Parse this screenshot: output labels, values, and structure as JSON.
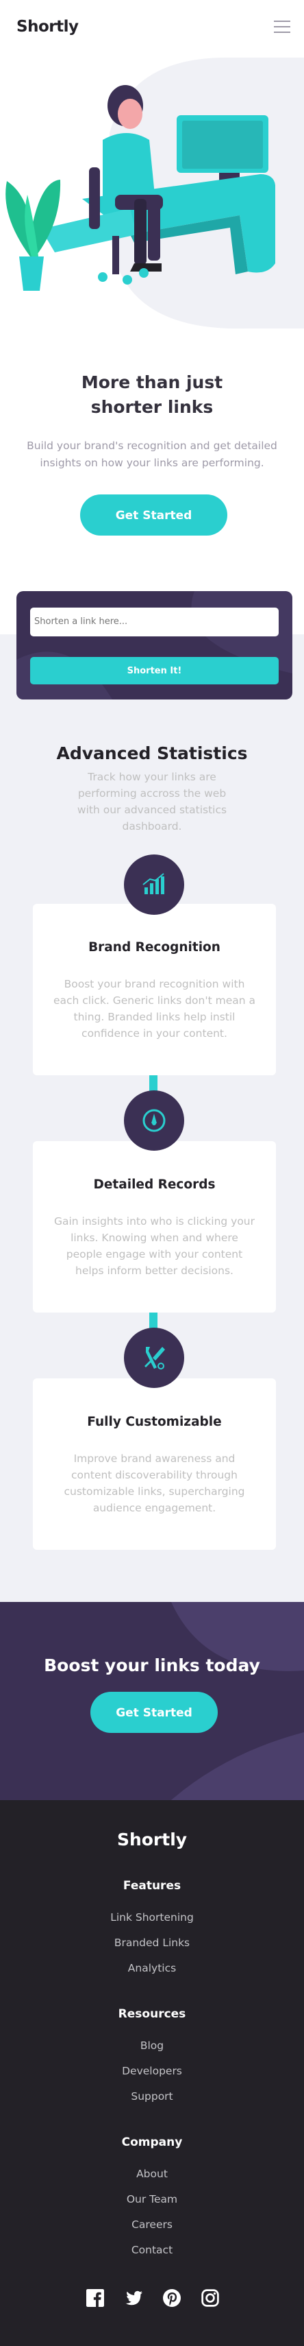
{
  "header": {
    "logo": "Shortly",
    "menu_icon": "hamburger-menu-icon"
  },
  "hero": {
    "title_line1": "More than just",
    "title_line2": "shorter links",
    "subtitle_line1": "Build your brand's recognition and get detailed",
    "subtitle_line2": "insights on how your links are performing.",
    "cta_label": "Get Started",
    "illustration": "person-working-at-desk-illustration"
  },
  "shorten": {
    "placeholder": "Shorten a link here...",
    "button_label": "Shorten It!"
  },
  "stats": {
    "title": "Advanced Statistics",
    "subtitle_lines": [
      "Track how your links are",
      "performing accross the web",
      "with our advanced statistics",
      "dashboard."
    ],
    "cards": [
      {
        "icon": "brand-recognition-chart-icon",
        "title": "Brand Recognition",
        "text_lines": [
          "Boost your brand recognition with",
          "each click. Generic links don't mean a",
          "thing. Branded links help instil",
          "confidence in your content."
        ]
      },
      {
        "icon": "detailed-records-gauge-icon",
        "title": "Detailed Records",
        "text_lines": [
          "Gain insights into who is clicking your",
          "links. Knowing when and where",
          "people engage with your content",
          "helps inform better decisions."
        ]
      },
      {
        "icon": "customizable-tools-icon",
        "title": "Fully Customizable",
        "text_lines": [
          "Improve brand awareness and",
          "content discoverability through",
          "customizable links, supercharging",
          "audience engagement."
        ]
      }
    ]
  },
  "boost": {
    "title": "Boost your links today",
    "cta_label": "Get Started"
  },
  "footer": {
    "logo": "Shortly",
    "columns": [
      {
        "heading": "Features",
        "links": [
          "Link Shortening",
          "Branded Links",
          "Analytics"
        ]
      },
      {
        "heading": "Resources",
        "links": [
          "Blog",
          "Developers",
          "Support"
        ]
      },
      {
        "heading": "Company",
        "links": [
          "About",
          "Our Team",
          "Careers",
          "Contact"
        ]
      }
    ],
    "social": [
      "facebook-icon",
      "twitter-icon",
      "pinterest-icon",
      "instagram-icon"
    ]
  },
  "colors": {
    "primary_cyan": "#2acfcf",
    "dark_violet": "#3b3054",
    "very_dark_violet": "#232127",
    "grayish_violet": "#9e9aa8",
    "light_gray_bg": "#f0f1f6"
  }
}
